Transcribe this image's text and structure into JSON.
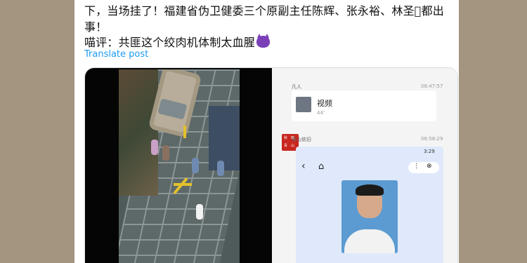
{
  "post": {
    "line1": "下，当场挂了！福建省伪卫健委三个原副主任陈辉、张永裕、林圣𫚫都出",
    "line2": "事！",
    "line3": "喵评：共匪这个绞肉机体制太血腥",
    "emoji": "smiling-devil-emoji",
    "translate": "Translate post"
  },
  "chat": {
    "msg1": {
      "user": "凡人",
      "time": "06:47:57",
      "title": "视频",
      "sub": "44″"
    },
    "msg2": {
      "user": "青山依旧",
      "time": "06:58:29",
      "avatar_text": [
        "秋",
        "鸣",
        "青",
        "山"
      ],
      "phone": {
        "clock": "3:29",
        "back": "‹",
        "home": "⌂",
        "more": "⋮",
        "close": "⊗"
      }
    }
  },
  "colors": {
    "background": "#a49580",
    "link": "#1d9bf0",
    "photo_bg": "#5b9bd1"
  }
}
